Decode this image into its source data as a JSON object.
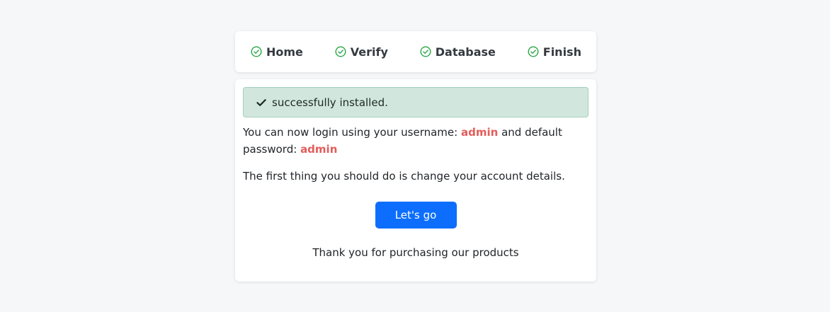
{
  "steps": [
    {
      "label": "Home",
      "icon": "check-circle-icon",
      "status": "done"
    },
    {
      "label": "Verify",
      "icon": "check-circle-icon",
      "status": "done"
    },
    {
      "label": "Database",
      "icon": "check-circle-icon",
      "status": "done"
    },
    {
      "label": "Finish",
      "icon": "check-circle-icon",
      "status": "done"
    }
  ],
  "alert": {
    "icon": "checkmark-icon",
    "message": "successfully installed."
  },
  "login_info": {
    "prefix": "You can now login using your username:",
    "username": "admin",
    "middle": "and default password:",
    "password": "admin"
  },
  "advice": "The first thing you should do is change your account details.",
  "button": {
    "label": "Let's go"
  },
  "thanks": "Thank you for purchasing our products",
  "colors": {
    "accent": "#0d6efd",
    "success_icon": "#28a745",
    "highlight": "#e35d5b",
    "alert_bg": "#d1e7dd",
    "page_bg": "#f6f7f9"
  }
}
